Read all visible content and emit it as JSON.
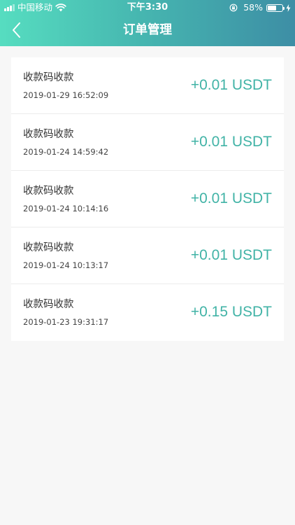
{
  "status_bar": {
    "carrier": "中国移动",
    "time": "下午3:30",
    "battery": "58%",
    "battery_level": 0.58,
    "icons": [
      "signal-icon",
      "wifi-icon",
      "rotation-lock-icon",
      "battery-icon",
      "charging-icon"
    ]
  },
  "header": {
    "title": "订单管理",
    "back_icon": "chevron-left-icon",
    "gradient_colors": [
      "#56ddc0",
      "#46b6b0",
      "#3d8ea5"
    ]
  },
  "orders": [
    {
      "title": "收款码收款",
      "time": "2019-01-29 16:52:09",
      "amount": "+0.01 USDT"
    },
    {
      "title": "收款码收款",
      "time": "2019-01-24 14:59:42",
      "amount": "+0.01 USDT"
    },
    {
      "title": "收款码收款",
      "time": "2019-01-24 10:14:16",
      "amount": "+0.01 USDT"
    },
    {
      "title": "收款码收款",
      "time": "2019-01-24 10:13:17",
      "amount": "+0.01 USDT"
    },
    {
      "title": "收款码收款",
      "time": "2019-01-23 19:31:17",
      "amount": "+0.15 USDT"
    }
  ],
  "colors": {
    "accent": "#41b3a6",
    "background": "#f7f7f7"
  }
}
